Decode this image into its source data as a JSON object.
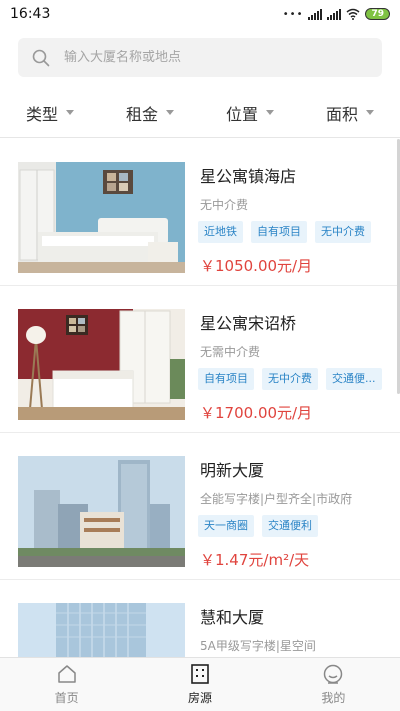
{
  "status_bar": {
    "time": "16:43",
    "dots": "•••",
    "battery": "79",
    "icons": [
      "signal-icon",
      "signal-icon",
      "wifi-icon",
      "battery-icon"
    ]
  },
  "search": {
    "placeholder": "输入大厦名称或地点",
    "icon": "search-icon"
  },
  "filters": [
    "类型",
    "租金",
    "位置",
    "面积"
  ],
  "listings": [
    {
      "name": "星公寓镇海店",
      "desc": "无中介费",
      "tags": [
        "近地铁",
        "自有项目",
        "无中介费"
      ],
      "price": "￥1050.00元/月",
      "image": "bedroom-blue-photo"
    },
    {
      "name": "星公寓宋诏桥",
      "desc": "无需中介费",
      "tags": [
        "自有项目",
        "无中介费",
        "交通便..."
      ],
      "price": "￥1700.00元/月",
      "image": "bedroom-red-photo"
    },
    {
      "name": "明新大厦",
      "desc": "全能写字楼|户型齐全|市政府",
      "tags": [
        "天一商圈",
        "交通便利"
      ],
      "price": "￥1.47元/m²/天",
      "image": "office-building-photo"
    },
    {
      "name": "慧和大厦",
      "desc": "5A甲级写字楼|星空间",
      "tags": [],
      "price": "",
      "image": "glass-tower-photo"
    }
  ],
  "tabbar": {
    "home": "首页",
    "listings": "房源",
    "mine": "我的",
    "active": "listings"
  },
  "colors": {
    "accent_price": "#e0443e",
    "tag_text": "#2a84c6",
    "tag_bg": "#e8f3fb",
    "battery": "#7fc243"
  }
}
